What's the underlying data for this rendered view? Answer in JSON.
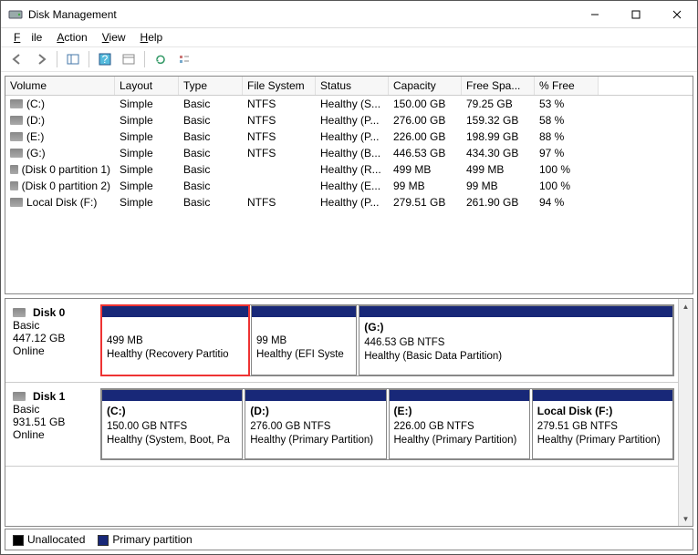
{
  "window": {
    "title": "Disk Management"
  },
  "menu": {
    "file": "File",
    "action": "Action",
    "view": "View",
    "help": "Help"
  },
  "columns": [
    "Volume",
    "Layout",
    "Type",
    "File System",
    "Status",
    "Capacity",
    "Free Spa...",
    "% Free"
  ],
  "volumes": [
    {
      "name": "(C:)",
      "layout": "Simple",
      "type": "Basic",
      "fs": "NTFS",
      "status": "Healthy (S...",
      "cap": "150.00 GB",
      "free": "79.25 GB",
      "pct": "53 %"
    },
    {
      "name": "(D:)",
      "layout": "Simple",
      "type": "Basic",
      "fs": "NTFS",
      "status": "Healthy (P...",
      "cap": "276.00 GB",
      "free": "159.32 GB",
      "pct": "58 %"
    },
    {
      "name": "(E:)",
      "layout": "Simple",
      "type": "Basic",
      "fs": "NTFS",
      "status": "Healthy (P...",
      "cap": "226.00 GB",
      "free": "198.99 GB",
      "pct": "88 %"
    },
    {
      "name": "(G:)",
      "layout": "Simple",
      "type": "Basic",
      "fs": "NTFS",
      "status": "Healthy (B...",
      "cap": "446.53 GB",
      "free": "434.30 GB",
      "pct": "97 %"
    },
    {
      "name": "(Disk 0 partition 1)",
      "layout": "Simple",
      "type": "Basic",
      "fs": "",
      "status": "Healthy (R...",
      "cap": "499 MB",
      "free": "499 MB",
      "pct": "100 %"
    },
    {
      "name": "(Disk 0 partition 2)",
      "layout": "Simple",
      "type": "Basic",
      "fs": "",
      "status": "Healthy (E...",
      "cap": "99 MB",
      "free": "99 MB",
      "pct": "100 %"
    },
    {
      "name": "Local Disk (F:)",
      "layout": "Simple",
      "type": "Basic",
      "fs": "NTFS",
      "status": "Healthy (P...",
      "cap": "279.51 GB",
      "free": "261.90 GB",
      "pct": "94 %"
    }
  ],
  "disks": [
    {
      "name": "Disk 0",
      "type": "Basic",
      "size": "447.12 GB",
      "state": "Online",
      "parts": [
        {
          "title": "",
          "line1": "499 MB",
          "line2": "Healthy (Recovery Partitio",
          "flex": 154,
          "highlight": true
        },
        {
          "title": "",
          "line1": "99 MB",
          "line2": "Healthy (EFI Syste",
          "flex": 110,
          "highlight": false
        },
        {
          "title": "(G:)",
          "line1": "446.53 GB NTFS",
          "line2": "Healthy (Basic Data Partition)",
          "flex": 330,
          "highlight": false
        }
      ]
    },
    {
      "name": "Disk 1",
      "type": "Basic",
      "size": "931.51 GB",
      "state": "Online",
      "parts": [
        {
          "title": "(C:)",
          "line1": "150.00 GB NTFS",
          "line2": "Healthy (System, Boot, Pa",
          "flex": 1,
          "highlight": false
        },
        {
          "title": "(D:)",
          "line1": "276.00 GB NTFS",
          "line2": "Healthy (Primary Partition)",
          "flex": 1,
          "highlight": false
        },
        {
          "title": "(E:)",
          "line1": "226.00 GB NTFS",
          "line2": "Healthy (Primary Partition)",
          "flex": 1,
          "highlight": false
        },
        {
          "title": "Local Disk  (F:)",
          "line1": "279.51 GB NTFS",
          "line2": "Healthy (Primary Partition)",
          "flex": 1,
          "highlight": false
        }
      ]
    }
  ],
  "legend": {
    "unallocated": "Unallocated",
    "primary": "Primary partition"
  }
}
